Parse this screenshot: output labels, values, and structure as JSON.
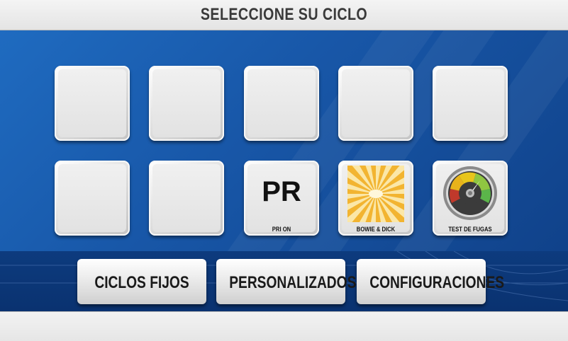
{
  "header": {
    "title": "SELECCIONE SU CICLO"
  },
  "cycles": {
    "pri_on": {
      "icon_text": "PR",
      "caption": "PRI ON"
    },
    "bowie_dick": {
      "caption": "BOWIE & DICK",
      "icon": "sunburst-icon"
    },
    "test_fugas": {
      "caption": "TEST DE FUGAS",
      "icon": "pressure-gauge-icon"
    }
  },
  "nav": {
    "ciclos_fijos": "CICLOS FIJOS",
    "personalizados": "PERSONALIZADOS",
    "configuraciones": "CONFIGURACIONES"
  },
  "colors": {
    "background_blue": "#1857a8",
    "gauge_red": "#c0392b",
    "gauge_yellow": "#e8b31b",
    "gauge_green": "#5bb54a",
    "sunburst_gold": "#f2b431"
  }
}
